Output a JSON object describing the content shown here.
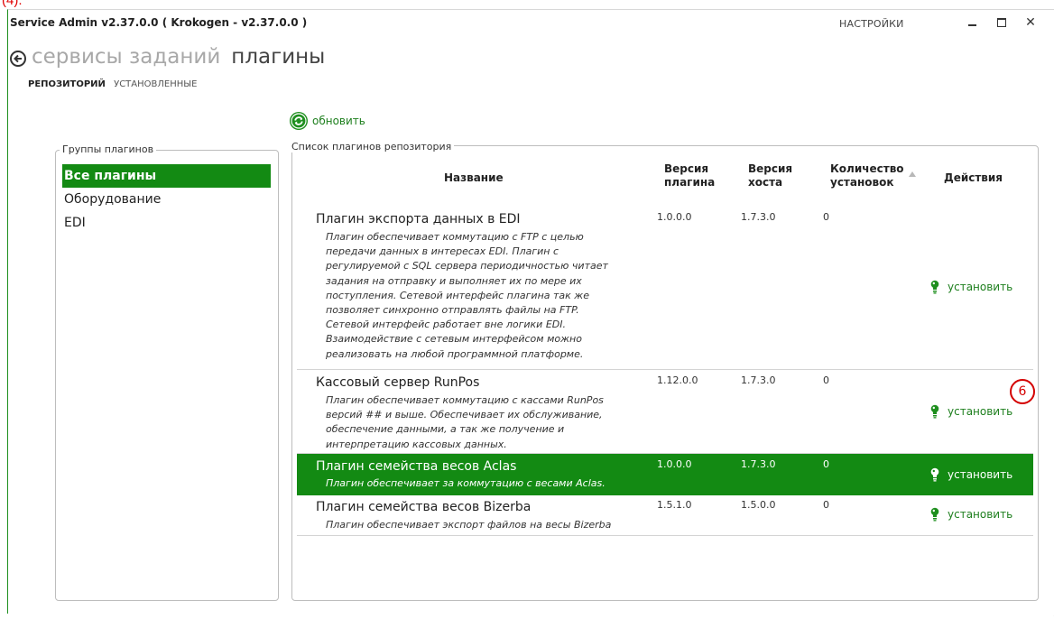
{
  "annotation_top": "(4).",
  "window": {
    "title": "Service Admin  v2.37.0.0  ( Krokogen - v2.37.0.0 )",
    "settings_label": "НАСТРОЙКИ",
    "close_glyph": "✕"
  },
  "breadcrumb": {
    "parent": "сервисы заданий",
    "current": "плагины"
  },
  "subtabs": {
    "active": "РЕПОЗИТОРИЙ",
    "other": "УСТАНОВЛЕННЫЕ"
  },
  "refresh_label": "обновить",
  "groups": {
    "legend": "Группы плагинов",
    "items": [
      "Все плагины",
      "Оборудование",
      "EDI"
    ],
    "selected_index": 0
  },
  "plugins": {
    "legend": "Список плагинов репозитория",
    "columns": {
      "name": "Название",
      "plugin_version_1": "Версия",
      "plugin_version_2": "плагина",
      "host_version_1": "Версия",
      "host_version_2": "хоста",
      "installs_1": "Количество",
      "installs_2": "установок",
      "actions": "Действия"
    },
    "rows": [
      {
        "name": "Плагин экспорта данных в EDI",
        "description": [
          "Плагин обеспечивает коммутацию с FTP с целью",
          "передачи данных в интересах EDI. Плагин с",
          "регулируемой с SQL сервера периодичностью читает",
          "задания на отправку и выполняет их по мере их",
          "поступления. Сетевой интерфейс плагина так же",
          "позволяет синхронно отправлять файлы на FTP.",
          "Сетевой интерфейс работает вне логики EDI.",
          "Взаимодействие с сетевым интерфейсом можно",
          "реализовать на любой программной платформе."
        ],
        "plugin_version": "1.0.0.0",
        "host_version": "1.7.3.0",
        "installs": "0",
        "action": "установить",
        "selected": false
      },
      {
        "name": "Кассовый сервер RunPos",
        "description": [
          "Плагин обеспечивает коммутацию с кассами RunPos",
          "версий ## и выше. Обеспечивает их обслуживание,",
          "обеспечение данными, а так же получение и",
          "интерпретацию кассовых данных."
        ],
        "plugin_version": "1.12.0.0",
        "host_version": "1.7.3.0",
        "installs": "0",
        "action": "установить",
        "selected": false
      },
      {
        "name": "Плагин семейства весов Aclas",
        "description": [
          "Плагин обеспечивает за коммутацию с весами Aclas."
        ],
        "plugin_version": "1.0.0.0",
        "host_version": "1.7.3.0",
        "installs": "0",
        "action": "установить",
        "selected": true
      },
      {
        "name": "Плагин семейства весов Bizerba",
        "description": [
          "Плагин обеспечивает экспорт файлов на весы Bizerba"
        ],
        "plugin_version": "1.5.1.0",
        "host_version": "1.5.0.0",
        "installs": "0",
        "action": "установить",
        "selected": false
      }
    ]
  },
  "callout_badge": "6",
  "colors": {
    "accent": "#138a13",
    "link": "#1e7f1e",
    "badge": "#d40000"
  }
}
